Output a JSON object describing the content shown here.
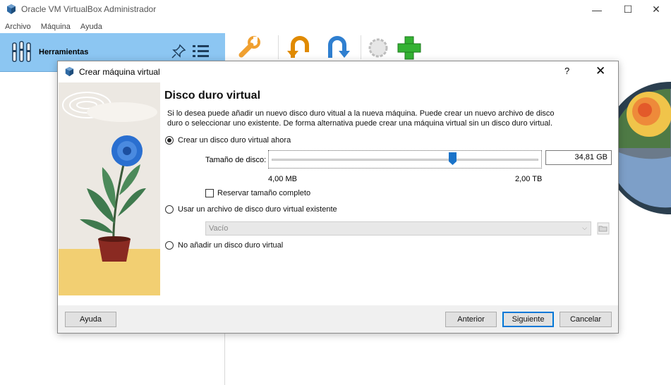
{
  "window": {
    "title": "Oracle VM VirtualBox Administrador",
    "minimize": "—",
    "maximize": "☐",
    "close": "✕"
  },
  "menu": [
    "Archivo",
    "Máquina",
    "Ayuda"
  ],
  "tools": {
    "label": "Herramientas"
  },
  "dialog": {
    "title": "Crear máquina virtual",
    "help_glyph": "?",
    "close_glyph": "✕",
    "heading": "Disco duro virtual",
    "description": "Si lo desea puede añadir un nuevo disco duro vitual a la nueva máquina. Puede crear un nuevo archivo de disco duro o seleccionar uno existente. De forma alternativa puede crear una máquina virtual sin un disco duro virtual.",
    "options": {
      "create_new": "Crear un disco duro virtual ahora",
      "use_existing": "Usar un archivo de disco duro virtual existente",
      "none": "No añadir un disco duro virtual"
    },
    "selected_option": "create_new",
    "disk_size": {
      "label": "Tamaño de disco:",
      "value": "34,81 GB",
      "min_label": "4,00 MB",
      "max_label": "2,00 TB",
      "slider_fraction": 0.68
    },
    "preallocate": {
      "label": "Reservar tamaño completo",
      "checked": false
    },
    "existing_file": {
      "value": "Vacío",
      "enabled": false
    },
    "buttons": {
      "help": "Ayuda",
      "back": "Anterior",
      "next": "Siguiente",
      "cancel": "Cancelar"
    }
  },
  "colors": {
    "tools_pane": "#8cc6f2",
    "accent": "#0078d7",
    "slider_thumb": "#1a73c9"
  }
}
